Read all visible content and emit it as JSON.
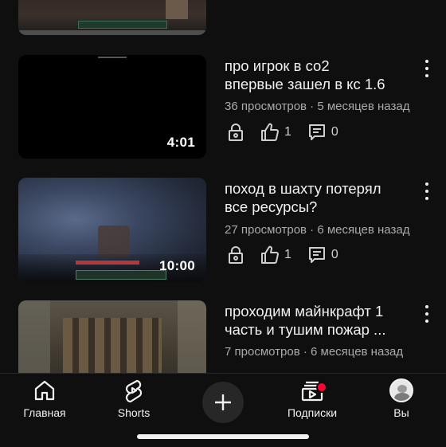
{
  "videos": [
    {
      "title_lines": [
        "про игрок в со2",
        "впервые зашел в кс 1.6"
      ],
      "meta": "36 просмотров · 5 месяцев назад",
      "duration": "4:01",
      "likes": "1",
      "comments": "0"
    },
    {
      "title_lines": [
        "поход в шахту потерял",
        "все ресурсы?"
      ],
      "meta": "27 просмотров · 6 месяцев назад",
      "duration": "10:00",
      "likes": "1",
      "comments": "0"
    },
    {
      "title_lines": [
        "проходим майнкрафт 1",
        "часть и тушим пожар ..."
      ],
      "meta": "7 просмотров · 6 месяцев назад"
    }
  ],
  "nav": {
    "home": "Главная",
    "shorts": "Shorts",
    "subscriptions": "Подписки",
    "you": "Вы"
  },
  "icons": {
    "home": "home-icon",
    "shorts": "shorts-icon",
    "create": "plus-icon",
    "subscriptions": "subscriptions-icon",
    "avatar": "avatar",
    "visibility": "lock-icon",
    "likes": "thumb-up-icon",
    "comments": "comment-icon",
    "more": "more-vert-icon"
  },
  "colors": {
    "background": "#0f0f0f",
    "text": "#f1f1f1",
    "secondary_text": "#aaaaaa",
    "notification_dot": "#ff0033"
  }
}
